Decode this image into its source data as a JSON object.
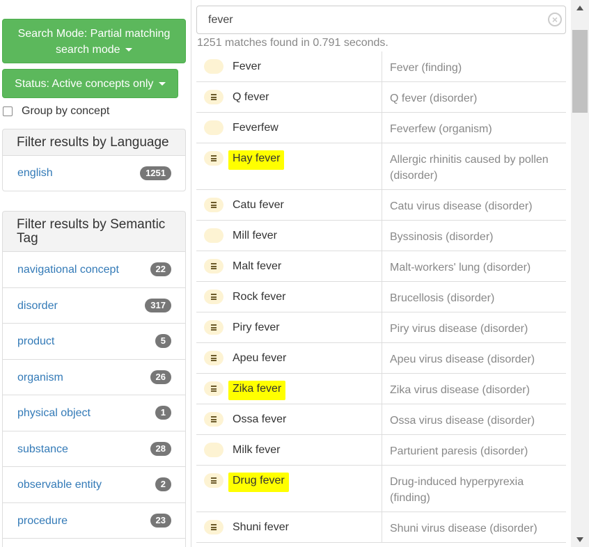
{
  "left": {
    "search_mode_line1": "Search Mode: Partial matching",
    "search_mode_line2": "search mode",
    "status_label": "Status: Active concepts only",
    "group_by_label": "Group by concept",
    "language_heading": "Filter results by Language",
    "languages": [
      {
        "label": "english",
        "count": "1251"
      }
    ],
    "semantic_heading": "Filter results by Semantic Tag",
    "semantic_tags": [
      {
        "label": "navigational concept",
        "count": "22"
      },
      {
        "label": "disorder",
        "count": "317"
      },
      {
        "label": "product",
        "count": "5"
      },
      {
        "label": "organism",
        "count": "26"
      },
      {
        "label": "physical object",
        "count": "1"
      },
      {
        "label": "substance",
        "count": "28"
      },
      {
        "label": "observable entity",
        "count": "2"
      },
      {
        "label": "procedure",
        "count": "23"
      }
    ]
  },
  "search": {
    "query": "fever",
    "clear_icon": "close-circle-icon",
    "match_info": "1251 matches found in 0.791 seconds."
  },
  "results": [
    {
      "term": "Fever",
      "fsn": "Fever (finding)",
      "icon": false,
      "highlight": false
    },
    {
      "term": "Q fever",
      "fsn": "Q fever (disorder)",
      "icon": true,
      "highlight": false
    },
    {
      "term": "Feverfew",
      "fsn": "Feverfew (organism)",
      "icon": false,
      "highlight": false
    },
    {
      "term": "Hay fever",
      "fsn": "Allergic rhinitis caused by pollen (disorder)",
      "icon": true,
      "highlight": true
    },
    {
      "term": "Catu fever",
      "fsn": "Catu virus disease (disorder)",
      "icon": true,
      "highlight": false
    },
    {
      "term": "Mill fever",
      "fsn": "Byssinosis (disorder)",
      "icon": false,
      "highlight": false
    },
    {
      "term": "Malt fever",
      "fsn": "Malt-workers' lung (disorder)",
      "icon": true,
      "highlight": false
    },
    {
      "term": "Rock fever",
      "fsn": "Brucellosis (disorder)",
      "icon": true,
      "highlight": false
    },
    {
      "term": "Piry fever",
      "fsn": "Piry virus disease (disorder)",
      "icon": true,
      "highlight": false
    },
    {
      "term": "Apeu fever",
      "fsn": "Apeu virus disease (disorder)",
      "icon": true,
      "highlight": false
    },
    {
      "term": "Zika fever",
      "fsn": "Zika virus disease (disorder)",
      "icon": true,
      "highlight": true
    },
    {
      "term": "Ossa fever",
      "fsn": "Ossa virus disease (disorder)",
      "icon": true,
      "highlight": false
    },
    {
      "term": "Milk fever",
      "fsn": "Parturient paresis (disorder)",
      "icon": false,
      "highlight": false
    },
    {
      "term": "Drug fever",
      "fsn": "Drug-induced hyperpyrexia (finding)",
      "icon": true,
      "highlight": true
    },
    {
      "term": "Shuni fever",
      "fsn": "Shuni virus disease (disorder)",
      "icon": true,
      "highlight": false
    }
  ],
  "colors": {
    "primary_button": "#5cb85c",
    "link": "#337ab7",
    "badge": "#777777",
    "highlight": "#ffff00",
    "concept_bullet": "#fdf3d3"
  }
}
